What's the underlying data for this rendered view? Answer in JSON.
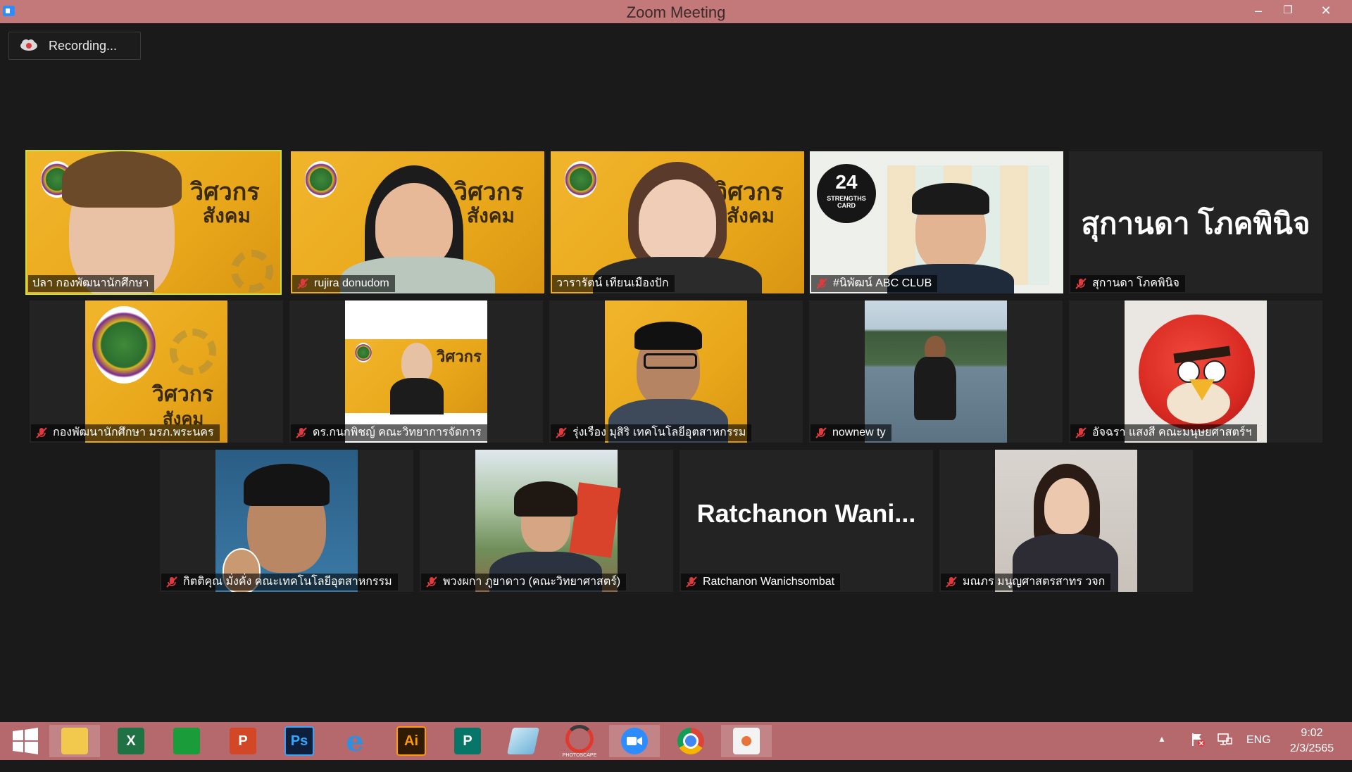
{
  "window": {
    "title": "Zoom Meeting",
    "minimize": "–",
    "restore": "❐",
    "close": "✕"
  },
  "recording": {
    "label": "Recording..."
  },
  "participants": [
    {
      "name": "ปลา กองพัฒนานักศึกษา",
      "muted": false,
      "active": true,
      "kind": "video-bg"
    },
    {
      "name": "rujira donudom",
      "muted": true,
      "kind": "video-bg"
    },
    {
      "name": "วารารัตน์ เทียนเมืองปัก",
      "muted": false,
      "kind": "video-bg"
    },
    {
      "name": "#นิพัฒน์ ABC CLUB",
      "muted": true,
      "kind": "video-card"
    },
    {
      "name": "สุกานดา โภคพินิจ",
      "muted": true,
      "kind": "name-only",
      "big_name": "สุกานดา โภคพินิจ"
    },
    {
      "name": "กองพัฒนานักศึกษา มรภ.พระนคร",
      "muted": true,
      "kind": "logo"
    },
    {
      "name": "ดร.กนกพิชญ์ คณะวิทยาการจัดการ",
      "muted": true,
      "kind": "photo"
    },
    {
      "name": "รุ่งเรือง มุสิริ เทคโนโลยีอุตสาหกรรม",
      "muted": true,
      "kind": "photo"
    },
    {
      "name": "nownew ty",
      "muted": true,
      "kind": "photo"
    },
    {
      "name": "อัจฉรา แสงสี คณะมนุษยศาสตร์ฯ",
      "muted": true,
      "kind": "photo"
    },
    {
      "name": "กิตติคุณ มั่งคั่ง คณะเทคโนโลยีอุตสาหกรรม",
      "muted": true,
      "kind": "photo"
    },
    {
      "name": "พวงผกา ภูยาดาว (คณะวิทยาศาสตร์)",
      "muted": true,
      "kind": "photo"
    },
    {
      "name": "Ratchanon Wanichsombat",
      "muted": true,
      "kind": "name-only",
      "big_name": "Ratchanon  Wani..."
    },
    {
      "name": "มณภร มนูญศาสตรสาทร วจก",
      "muted": true,
      "kind": "photo"
    }
  ],
  "slide_text": {
    "line1": "วิศวกร",
    "line2": "สังคม"
  },
  "card_text": {
    "num": "24",
    "line1": "STRENGTHS",
    "line2": "CARD"
  },
  "taskbar": {
    "apps": [
      "start-icon",
      "file-explorer-icon",
      "excel-icon",
      "store-icon",
      "powerpoint-icon",
      "photoshop-icon",
      "internet-explorer-icon",
      "illustrator-icon",
      "publisher-icon",
      "notepad-icon",
      "photoscape-icon",
      "zoom-icon",
      "chrome-icon",
      "paint-icon"
    ],
    "labels": {
      "excel": "X",
      "powerpoint": "P",
      "photoshop": "Ps",
      "illustrator": "Ai",
      "publisher": "P",
      "ie": "e"
    },
    "photoscape_caption": "PHOTOSCAPE"
  },
  "tray": {
    "language": "ENG",
    "time": "9:02",
    "date": "2/3/2565"
  }
}
